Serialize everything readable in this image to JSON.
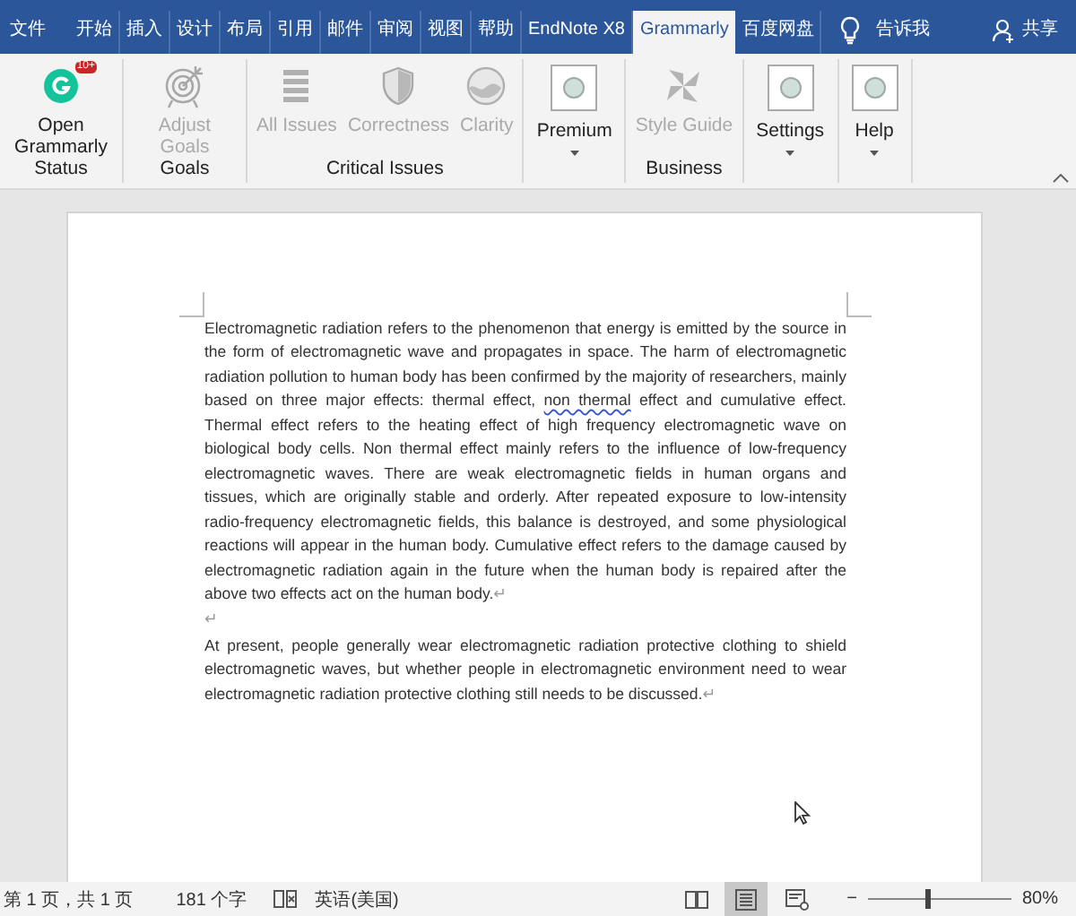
{
  "tabs": [
    {
      "label": "文件",
      "selected": false
    },
    {
      "label": "开始",
      "selected": false
    },
    {
      "label": "插入",
      "selected": false
    },
    {
      "label": "设计",
      "selected": false
    },
    {
      "label": "布局",
      "selected": false
    },
    {
      "label": "引用",
      "selected": false
    },
    {
      "label": "邮件",
      "selected": false
    },
    {
      "label": "审阅",
      "selected": false
    },
    {
      "label": "视图",
      "selected": false
    },
    {
      "label": "帮助",
      "selected": false
    },
    {
      "label": "EndNote X8",
      "selected": false
    },
    {
      "label": "Grammarly",
      "selected": true
    },
    {
      "label": "百度网盘",
      "selected": false
    }
  ],
  "tell_me": "告诉我",
  "share": "共享",
  "ribbon_groups": [
    {
      "label": "Status",
      "items": [
        {
          "kind": "logo",
          "label": "Open Grammarly",
          "badge": "10+",
          "disabled": false
        }
      ]
    },
    {
      "label": "Goals",
      "items": [
        {
          "kind": "target",
          "label": "Adjust Goals",
          "disabled": true
        }
      ]
    },
    {
      "label": "Critical Issues",
      "items": [
        {
          "kind": "list",
          "label": "All Issues",
          "disabled": true
        },
        {
          "kind": "shield",
          "label": "Correctness",
          "disabled": true
        },
        {
          "kind": "dial",
          "label": "Clarity",
          "disabled": true
        }
      ]
    },
    {
      "items": [
        {
          "kind": "dropdown",
          "label": "Premium",
          "disabled": false
        }
      ]
    },
    {
      "label": "Business",
      "items": [
        {
          "kind": "pinwheel",
          "label": "Style Guide",
          "disabled": true
        }
      ]
    },
    {
      "items": [
        {
          "kind": "dropdown",
          "label": "Settings",
          "disabled": false
        }
      ]
    },
    {
      "items": [
        {
          "kind": "dropdown",
          "label": "Help",
          "disabled": false
        }
      ]
    }
  ],
  "document": {
    "paragraphs": [
      {
        "segments": [
          {
            "text": "Electromagnetic radiation refers to the phenomenon that energy is emitted by the source in the form of electromagnetic wave and propagates in space. The harm of electromagnetic radiation pollution to human body has been confirmed by the majority of researchers, mainly based on three major effects: thermal effect, ",
            "flagged": false
          },
          {
            "text": "non thermal",
            "flagged": true
          },
          {
            "text": " effect and cumulative effect. Thermal effect refers to the heating effect of high frequency electromagnetic wave on biological body cells. Non thermal effect mainly refers to the influence of low-frequency electromagnetic waves. There are weak electromagnetic fields in human organs and tissues, which are originally stable and orderly. After repeated exposure to low-intensity radio-frequency electromagnetic fields, this balance is destroyed, and some physiological reactions will appear in the human body. Cumulative effect refers to the damage caused by electromagnetic radiation again in the future when the human body is repaired after the above two effects act on the human body.",
            "flagged": false
          }
        ],
        "mark": "↵"
      },
      {
        "mark": "↵"
      },
      {
        "segments": [
          {
            "text": "At present, people generally wear electromagnetic radiation protective clothing to shield electromagnetic waves, but whether people in electromagnetic environment need to wear electromagnetic radiation protective clothing still needs to be discussed.",
            "flagged": false
          }
        ],
        "mark": "↵"
      }
    ]
  },
  "status_bar": {
    "page": "第 1 页，共 1 页",
    "words": "181 个字",
    "language": "英语(美国)",
    "views": [
      {
        "kind": "read",
        "selected": false
      },
      {
        "kind": "print",
        "selected": true
      },
      {
        "kind": "web",
        "selected": false
      }
    ],
    "zoom_out": "−",
    "zoom_slider": {
      "level": 0.4
    },
    "zoom": "80%"
  }
}
